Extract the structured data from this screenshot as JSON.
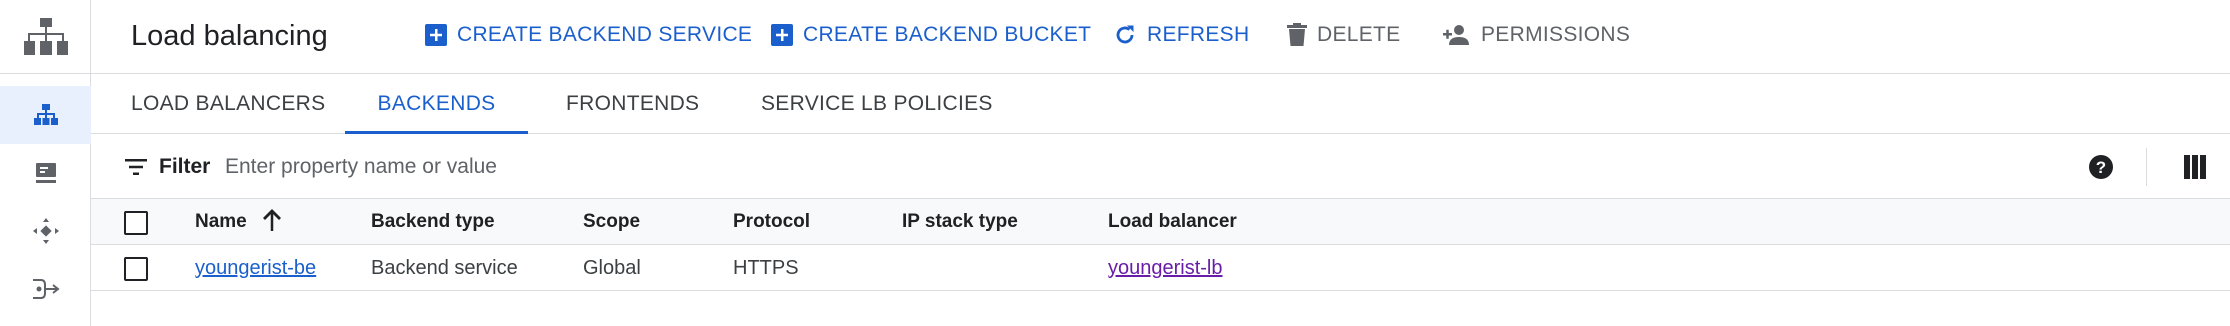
{
  "header": {
    "title": "Load balancing",
    "actions": [
      {
        "label": "CREATE BACKEND SERVICE",
        "icon": "add-box-icon",
        "state": "enabled"
      },
      {
        "label": "CREATE BACKEND BUCKET",
        "icon": "add-box-icon",
        "state": "enabled"
      },
      {
        "label": "REFRESH",
        "icon": "refresh-icon",
        "state": "enabled"
      },
      {
        "label": "DELETE",
        "icon": "trash-icon",
        "state": "disabled"
      },
      {
        "label": "PERMISSIONS",
        "icon": "person-add-icon",
        "state": "disabled"
      }
    ]
  },
  "rail": {
    "items": [
      {
        "icon": "network-hierarchy-icon",
        "active": true
      },
      {
        "icon": "vm-instance-icon",
        "active": false
      },
      {
        "icon": "routing-diamond-icon",
        "active": false
      },
      {
        "icon": "traffic-split-icon",
        "active": false
      }
    ]
  },
  "tabs": [
    {
      "label": "LOAD BALANCERS",
      "active": false
    },
    {
      "label": "BACKENDS",
      "active": true
    },
    {
      "label": "FRONTENDS",
      "active": false
    },
    {
      "label": "SERVICE LB POLICIES",
      "active": false
    }
  ],
  "filter": {
    "label": "Filter",
    "placeholder": "Enter property name or value"
  },
  "table": {
    "columns": [
      "Name",
      "Backend type",
      "Scope",
      "Protocol",
      "IP stack type",
      "Load balancer"
    ],
    "sort_column": "Name",
    "sort_direction": "ascending",
    "rows": [
      {
        "name": "youngerist-be",
        "backend_type": "Backend service",
        "scope": "Global",
        "protocol": "HTTPS",
        "ip_stack_type": "",
        "load_balancer": "youngerist-lb"
      }
    ]
  },
  "colors": {
    "accent": "#1a5fcc",
    "visited_link": "#681da8",
    "disabled_text": "#5f6368",
    "border": "#dadce0",
    "active_rail_bg": "#e8f0fe"
  }
}
